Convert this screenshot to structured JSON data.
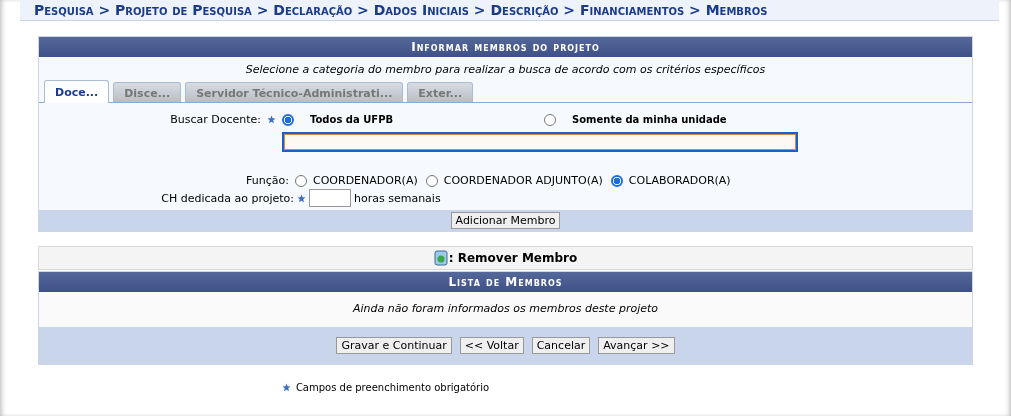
{
  "breadcrumb": "Pesquisa > Projeto de Pesquisa > Declaração > Dados Iniciais > Descrição > Financiamentos > Membros",
  "form": {
    "title": "Informar membros do projeto",
    "instruction": "Selecione a categoria do membro para realizar a busca de acordo com os critérios específicos",
    "tabs": [
      {
        "label": "Doce...",
        "selected": true
      },
      {
        "label": "Disce...",
        "selected": false
      },
      {
        "label": "Servidor Técnico-Administrati...",
        "selected": false
      },
      {
        "label": "Exter...",
        "selected": false
      }
    ],
    "search": {
      "label": "Buscar Docente:",
      "required": true,
      "options": [
        {
          "label": "Todos da UFPB",
          "selected": true
        },
        {
          "label": "Somente da minha unidade",
          "selected": false
        }
      ]
    },
    "role": {
      "label": "Função:",
      "options": [
        {
          "label": "COORDENADOR(A)",
          "selected": false
        },
        {
          "label": "COORDENADOR ADJUNTO(A)",
          "selected": false
        },
        {
          "label": "COLABORADOR(A)",
          "selected": true
        }
      ]
    },
    "hours": {
      "label": "CH dedicada ao projeto:",
      "required": true,
      "unit": "horas semanais"
    },
    "add_button": "Adicionar Membro"
  },
  "legend": ": Remover Membro",
  "members": {
    "title": "Lista de Membros",
    "empty_message": "Ainda não foram informados os membros deste projeto"
  },
  "buttons": [
    "Gravar e Continuar",
    "<< Voltar",
    "Cancelar",
    "Avançar >>"
  ],
  "footnote": "Campos de preenchimento obrigatório"
}
